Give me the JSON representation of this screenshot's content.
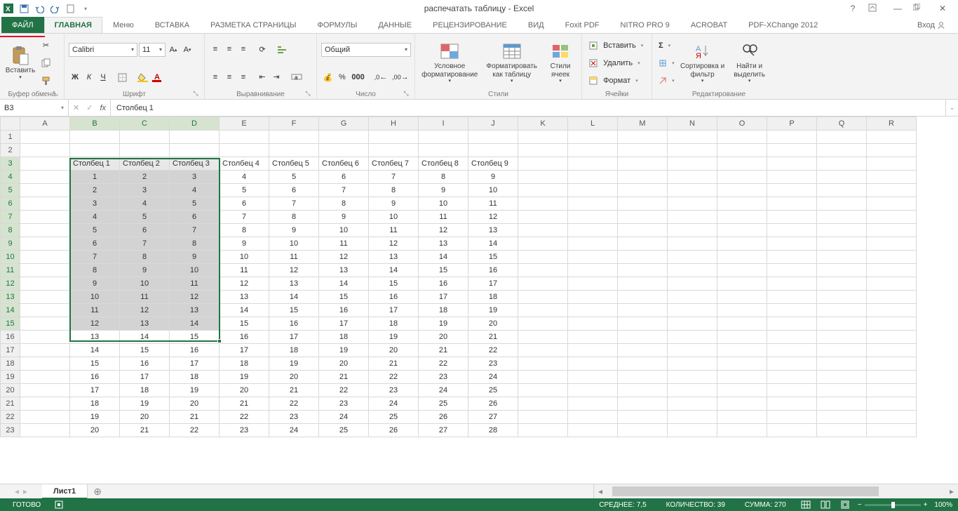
{
  "title": "распечатать таблицу - Excel",
  "tabs": {
    "file": "ФАЙЛ",
    "list": [
      "ГЛАВНАЯ",
      "Меню",
      "ВСТАВКА",
      "РАЗМЕТКА СТРАНИЦЫ",
      "ФОРМУЛЫ",
      "ДАННЫЕ",
      "РЕЦЕНЗИРОВАНИЕ",
      "ВИД",
      "Foxit PDF",
      "NITRO PRO 9",
      "ACROBAT",
      "PDF-XChange 2012"
    ],
    "login": "Вход"
  },
  "ribbon": {
    "clipboard": {
      "paste": "Вставить",
      "label": "Буфер обмена"
    },
    "font": {
      "name": "Calibri",
      "size": "11",
      "label": "Шрифт",
      "bold": "Ж",
      "italic": "К",
      "underline": "Ч"
    },
    "align": {
      "label": "Выравнивание"
    },
    "number": {
      "fmt": "Общий",
      "label": "Число"
    },
    "styles": {
      "cond": "Условное форматирование",
      "astable": "Форматировать как таблицу",
      "cell": "Стили ячеек",
      "label": "Стили"
    },
    "cells": {
      "insert": "Вставить",
      "delete": "Удалить",
      "format": "Формат",
      "label": "Ячейки"
    },
    "edit": {
      "sort": "Сортировка и фильтр",
      "find": "Найти и выделить",
      "label": "Редактирование"
    }
  },
  "fx": {
    "cell": "B3",
    "value": "Столбец 1"
  },
  "columns": [
    "A",
    "B",
    "C",
    "D",
    "E",
    "F",
    "G",
    "H",
    "I",
    "J",
    "K",
    "L",
    "M",
    "N",
    "O",
    "P",
    "Q",
    "R"
  ],
  "sel_cols": [
    "B",
    "C",
    "D"
  ],
  "sel_rows_from": 3,
  "sel_rows_to": 15,
  "headers": [
    "Столбец 1",
    "Столбец 2",
    "Столбец 3",
    "Столбец 4",
    "Столбец 5",
    "Столбец 6",
    "Столбец 7",
    "Столбец 8",
    "Столбец 9"
  ],
  "row_count_visible": 23,
  "data_row_start": 4,
  "data_start_value": 1,
  "data_cols": 9,
  "data_rows": 20,
  "sheet": "Лист1",
  "status": {
    "ready": "ГОТОВО",
    "avg_l": "СРЕДНЕЕ:",
    "avg": "7,5",
    "cnt_l": "КОЛИЧЕСТВО:",
    "cnt": "39",
    "sum_l": "СУММА:",
    "sum": "270",
    "zoom": "100%"
  }
}
